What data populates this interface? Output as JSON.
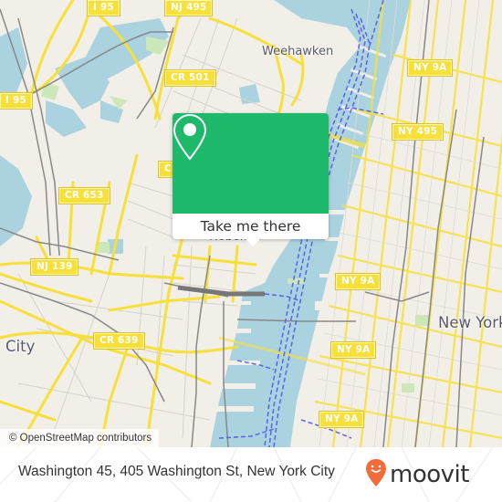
{
  "map": {
    "colors": {
      "land": "#f2efe9",
      "water": "#aad3df",
      "road": "#f7e03a",
      "rail": "#888888",
      "ferry": "#5a63e8",
      "park": "#cde8b8"
    },
    "shields": [
      {
        "id": "i95-top",
        "label": "I 95"
      },
      {
        "id": "nj495",
        "label": "NJ 495"
      },
      {
        "id": "i95-left",
        "label": "I 95"
      },
      {
        "id": "cr501",
        "label": "CR 501"
      },
      {
        "id": "cr-partial",
        "label": "CR"
      },
      {
        "id": "cr653",
        "label": "CR 653"
      },
      {
        "id": "nj139",
        "label": "NJ 139"
      },
      {
        "id": "cr639",
        "label": "CR 639"
      },
      {
        "id": "ny9a-1",
        "label": "NY 9A"
      },
      {
        "id": "ny495",
        "label": "NY 495"
      },
      {
        "id": "ny9a-2",
        "label": "NY 9A"
      },
      {
        "id": "ny9a-3",
        "label": "NY 9A"
      },
      {
        "id": "ny9a-4",
        "label": "NY 9A"
      }
    ],
    "places": [
      {
        "id": "weehawken",
        "label": "Weehawken"
      },
      {
        "id": "hoboken",
        "label": "Hoboken"
      },
      {
        "id": "new-york",
        "label": "New York"
      },
      {
        "id": "jersey-city",
        "label": "City"
      }
    ],
    "attribution": "© OpenStreetMap contributors"
  },
  "popup": {
    "icon": "location-pin-icon",
    "button_label": "Take me there",
    "color": "#1fb96b"
  },
  "footer": {
    "address": "Washington 45, 405 Washington St, New York City",
    "brand": "moovit",
    "brand_color": "#f26b3a"
  }
}
